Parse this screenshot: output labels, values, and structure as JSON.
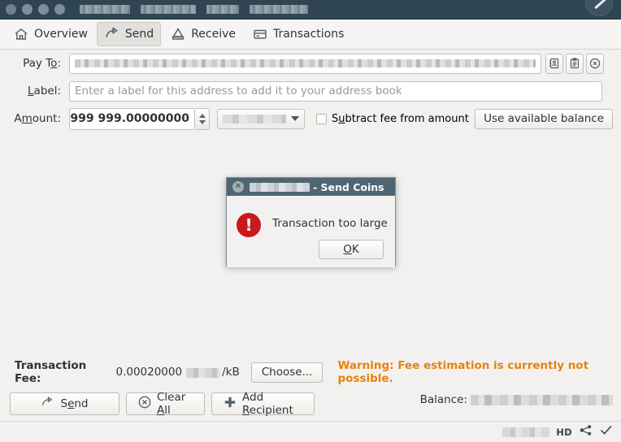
{
  "window": {
    "titlebar_redacted": true,
    "dot_count": 4,
    "cursor_icon": "cursor-arrow-icon"
  },
  "toolbar": {
    "items": [
      {
        "label": "Overview",
        "icon": "home-icon",
        "active": false
      },
      {
        "label": "Send",
        "icon": "send-arrow-icon",
        "active": true
      },
      {
        "label": "Receive",
        "icon": "receive-envelope-icon",
        "active": false
      },
      {
        "label": "Transactions",
        "icon": "transactions-card-icon",
        "active": false
      }
    ]
  },
  "form": {
    "payto": {
      "label_pre": "Pay T",
      "label_accel": "o",
      "label_post": ":",
      "value": "",
      "buttons": [
        {
          "name": "address-book-button",
          "icon": "address-book-icon"
        },
        {
          "name": "paste-address-button",
          "icon": "clipboard-icon"
        },
        {
          "name": "clear-address-button",
          "icon": "clear-circle-x-icon"
        }
      ]
    },
    "label_field": {
      "label_pre": "",
      "label_accel": "L",
      "label_post": "abel:",
      "placeholder": "Enter a label for this address to add it to your address book",
      "value": ""
    },
    "amount": {
      "label_pre": "A",
      "label_accel": "m",
      "label_post": "ount:",
      "value": "999 999.00000000",
      "unit_redacted": true,
      "subtract_fee": {
        "pre": "S",
        "accel": "u",
        "post": "btract fee from amount",
        "checked": false
      },
      "use_available_balance": "Use available balance"
    }
  },
  "fee": {
    "label": "Transaction Fee:",
    "value": "0.00020000",
    "unit_redacted": true,
    "per": "/kB",
    "choose_button": "Choose...",
    "warning": "Warning: Fee estimation is currently not possible."
  },
  "actions": {
    "send": {
      "pre": "S",
      "accel": "e",
      "post": "nd",
      "icon": "send-arrow-icon"
    },
    "clear_all": {
      "pre": "Clear ",
      "accel": "A",
      "post": "ll",
      "icon": "clear-circle-x-icon"
    },
    "add_recipient": {
      "pre": "Add ",
      "accel": "R",
      "post": "ecipient",
      "icon": "plus-icon"
    }
  },
  "balance": {
    "label": "Balance:",
    "value_redacted": true
  },
  "statusbar": {
    "redacted_item": true,
    "hd_label": "HD",
    "icons": [
      "network-connections-icon",
      "sync-check-icon"
    ]
  },
  "dialog": {
    "title_redacted": true,
    "title_text": "- Send Coins",
    "close_icon": "close-icon",
    "error_icon": "error-exclamation-icon",
    "message": "Transaction too large",
    "ok_button": {
      "pre": "",
      "accel": "O",
      "post": "K"
    }
  },
  "colors": {
    "titlebar": "#2f4552",
    "dialog_titlebar": "#4f6672",
    "warning": "#e8820c",
    "error": "#c9191b",
    "body": "#f2f1f0"
  }
}
